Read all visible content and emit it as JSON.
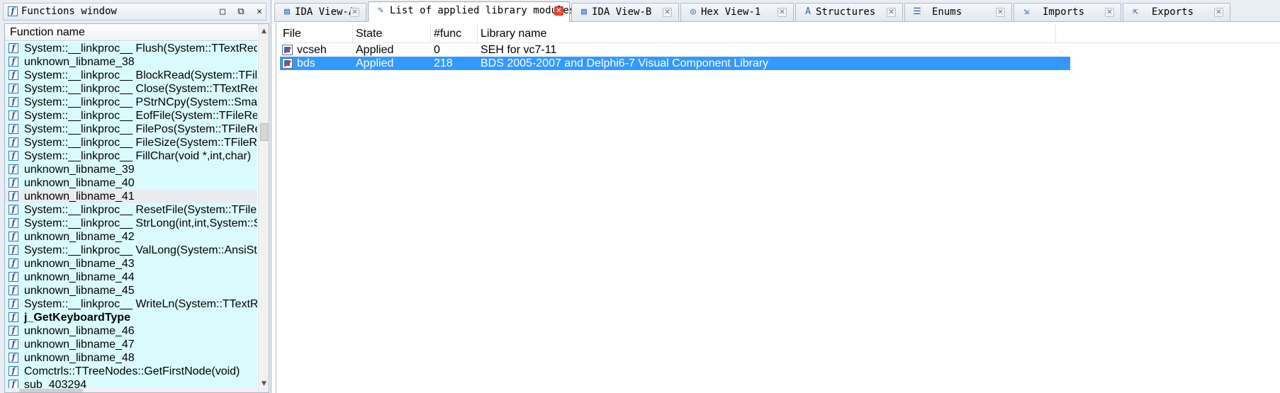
{
  "functions_window": {
    "title": "Functions window",
    "column_header": "Function name",
    "buttons": {
      "restore": "□",
      "float": "⧉",
      "close": "✕"
    },
    "rows": [
      {
        "name": "System::__linkproc__ Flush(System::TTextRec &",
        "bold": false,
        "selected": false
      },
      {
        "name": "unknown_libname_38",
        "bold": false,
        "selected": false
      },
      {
        "name": "System::__linkproc__ BlockRead(System::TFileR",
        "bold": false,
        "selected": false
      },
      {
        "name": "System::__linkproc__ Close(System::TTextRec &",
        "bold": false,
        "selected": false
      },
      {
        "name": "System::__linkproc__ PStrNCpy(System::SmallS",
        "bold": false,
        "selected": false
      },
      {
        "name": "System::__linkproc__ EofFile(System::TFileRec",
        "bold": false,
        "selected": false
      },
      {
        "name": "System::__linkproc__ FilePos(System::TFileRec",
        "bold": false,
        "selected": false
      },
      {
        "name": "System::__linkproc__ FileSize(System::TFileRec",
        "bold": false,
        "selected": false
      },
      {
        "name": "System::__linkproc__ FillChar(void *,int,char)",
        "bold": false,
        "selected": false
      },
      {
        "name": "unknown_libname_39",
        "bold": false,
        "selected": false
      },
      {
        "name": "unknown_libname_40",
        "bold": false,
        "selected": false
      },
      {
        "name": "unknown_libname_41",
        "bold": false,
        "selected": true
      },
      {
        "name": "System::__linkproc__ ResetFile(System::TFileRe",
        "bold": false,
        "selected": false
      },
      {
        "name": "System::__linkproc__ StrLong(int,int,System::S",
        "bold": false,
        "selected": false
      },
      {
        "name": "unknown_libname_42",
        "bold": false,
        "selected": false
      },
      {
        "name": "System::__linkproc__ ValLong(System::AnsiStri",
        "bold": false,
        "selected": false
      },
      {
        "name": "unknown_libname_43",
        "bold": false,
        "selected": false
      },
      {
        "name": "unknown_libname_44",
        "bold": false,
        "selected": false
      },
      {
        "name": "unknown_libname_45",
        "bold": false,
        "selected": false
      },
      {
        "name": "System::__linkproc__ WriteLn(System::TTextRe",
        "bold": false,
        "selected": false
      },
      {
        "name": "j_GetKeyboardType",
        "bold": true,
        "selected": false
      },
      {
        "name": "unknown_libname_46",
        "bold": false,
        "selected": false
      },
      {
        "name": "unknown_libname_47",
        "bold": false,
        "selected": false
      },
      {
        "name": "unknown_libname_48",
        "bold": false,
        "selected": false
      },
      {
        "name": "Comctrls::TTreeNodes::GetFirstNode(void)",
        "bold": false,
        "selected": false
      },
      {
        "name": "sub_403294",
        "bold": false,
        "selected": false
      }
    ]
  },
  "tabs": [
    {
      "label": "IDA View-A",
      "icon": "ida-view-icon",
      "active": false,
      "close_red": false
    },
    {
      "label": "List of applied library modules",
      "icon": "doc-icon",
      "active": true,
      "close_red": true
    },
    {
      "label": "IDA View-B",
      "icon": "ida-view-icon",
      "active": false,
      "close_red": false
    },
    {
      "label": "Hex View-1",
      "icon": "hex-view-icon",
      "active": false,
      "close_red": false
    },
    {
      "label": "Structures",
      "icon": "structures-icon",
      "active": false,
      "close_red": false
    },
    {
      "label": "Enums",
      "icon": "enums-icon",
      "active": false,
      "close_red": false
    },
    {
      "label": "Imports",
      "icon": "imports-icon",
      "active": false,
      "close_red": false
    },
    {
      "label": "Exports",
      "icon": "exports-icon",
      "active": false,
      "close_red": false
    }
  ],
  "library_modules": {
    "columns": [
      "File",
      "State",
      "#func",
      "Library name"
    ],
    "rows": [
      {
        "file": "vcseh",
        "state": "Applied",
        "funcs": "0",
        "library": "SEH for vc7-11",
        "selected": false
      },
      {
        "file": "bds",
        "state": "Applied",
        "funcs": "218",
        "library": "BDS 2005-2007 and Delphi6-7 Visual Component Library",
        "selected": true
      }
    ]
  },
  "colors": {
    "selection": "#3399ff",
    "function_row_bg": "#d9fbfd",
    "close_tab_red": "#e34a33"
  }
}
